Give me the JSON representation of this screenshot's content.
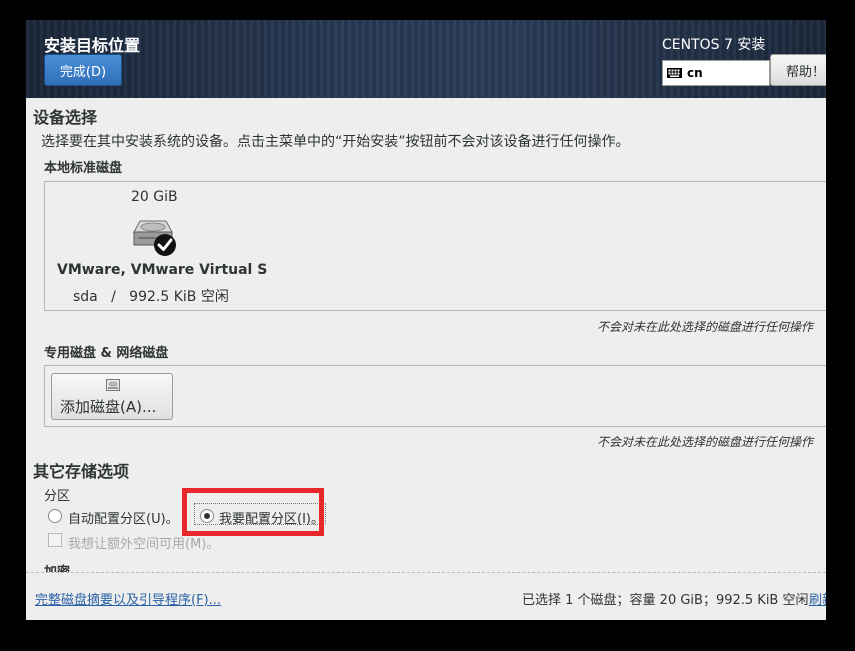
{
  "header": {
    "title": "安装目标位置",
    "done_label": "完成(D)",
    "product": "CENTOS 7 安装",
    "keyboard_layout": "cn",
    "help_label": "帮助！"
  },
  "device_selection": {
    "title": "设备选择",
    "description": "选择要在其中安装系统的设备。点击主菜单中的“开始安装”按钮前不会对该设备进行任何操作。",
    "local_disks": {
      "title": "本地标准磁盘",
      "disks": [
        {
          "size": "20 GiB",
          "name": "VMware, VMware Virtual S",
          "info": "sda   /   992.5 KiB 空闲",
          "selected": true
        }
      ],
      "note": "不会对未在此处选择的磁盘进行任何操作"
    },
    "special_disks": {
      "title": "专用磁盘 & 网络磁盘",
      "add_label": "添加磁盘(A)...",
      "note": "不会对未在此处选择的磁盘进行任何操作"
    }
  },
  "other_storage": {
    "title": "其它存储选项",
    "partition_label": "分区",
    "auto_label": "自动配置分区(U)。",
    "manual_label": "我要配置分区(I)。",
    "selected": "manual",
    "extra_space_label": "我想让额外空间可用(M)。",
    "encryption_label": "加密"
  },
  "footer": {
    "summary_link": "完整磁盘摘要以及引导程序(F)...",
    "status": "已选择 1 个磁盘；容量 20 GiB；992.5 KiB 空闲",
    "refresh_label": "刷新"
  },
  "colors": {
    "highlight": "#e8262b",
    "done_button": "#3b7fc6",
    "link": "#2a61a8"
  }
}
